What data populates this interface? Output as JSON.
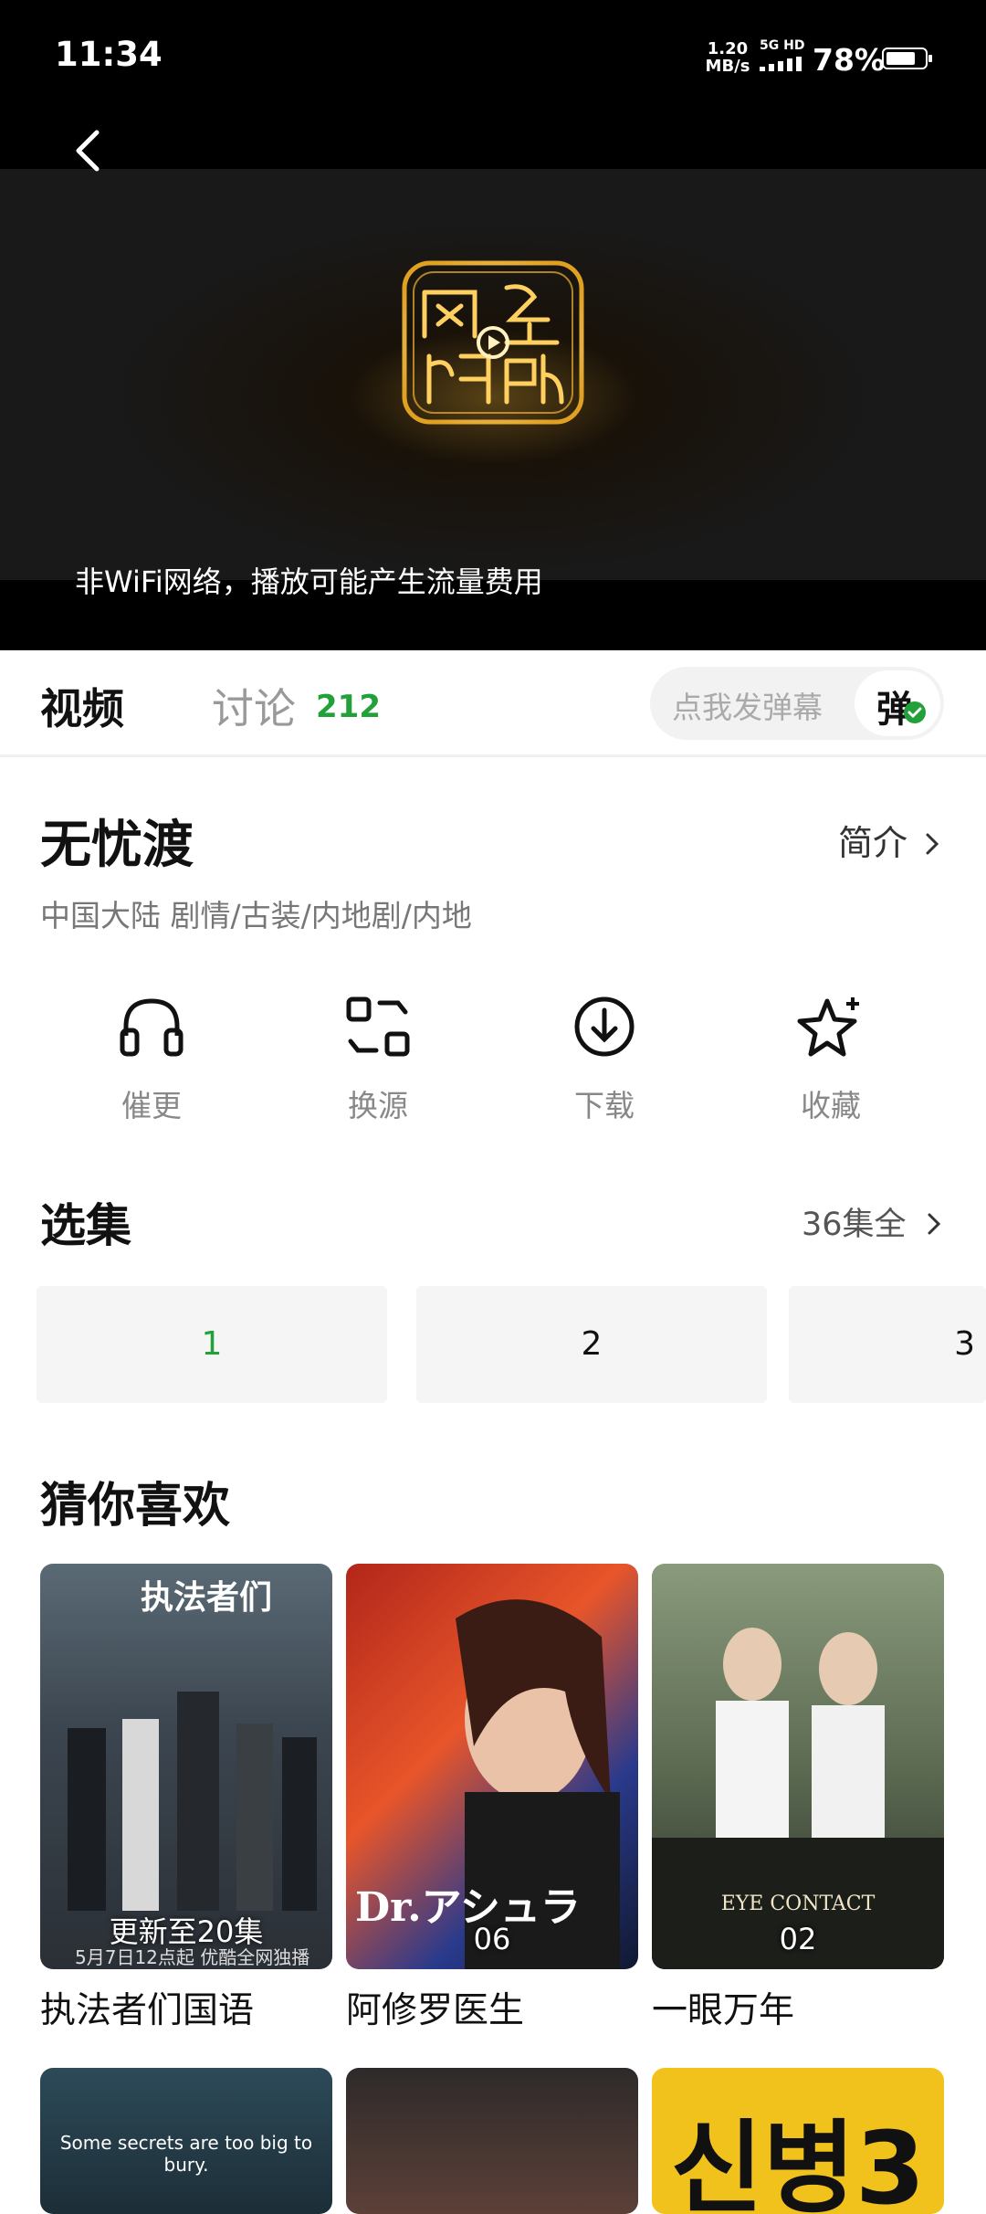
{
  "status_bar": {
    "time": "11:34",
    "net_speed_value": "1.20",
    "net_speed_unit": "MB/s",
    "network_label": "5G HD",
    "battery_percent": "78%",
    "battery_level": 0.78
  },
  "player": {
    "wifi_notice": "非WiFi网络，播放可能产生流量费用",
    "logo_icon": "wangluo-shiting-logo"
  },
  "tabs": {
    "video": "视频",
    "discuss": "讨论",
    "discuss_count": "212",
    "danmaku_placeholder": "点我发弹幕",
    "danmaku_button": "弹"
  },
  "show": {
    "title": "无忧渡",
    "intro_link": "简介",
    "meta": "中国大陆  剧情/古装/内地剧/内地"
  },
  "actions": [
    {
      "label": "催更",
      "icon": "headphones-icon"
    },
    {
      "label": "换源",
      "icon": "switch-source-icon"
    },
    {
      "label": "下载",
      "icon": "download-icon"
    },
    {
      "label": "收藏",
      "icon": "star-icon"
    }
  ],
  "episodes": {
    "heading": "选集",
    "count_link": "36集全",
    "items": [
      "1",
      "2",
      "3"
    ],
    "selected": "1"
  },
  "recommendations": {
    "heading": "猜你喜欢",
    "items": [
      {
        "title": "执法者们国语",
        "badge": "更新至20集",
        "poster_caption": "执法者们",
        "poster_note": "5月7日12点起 优酷全网独播"
      },
      {
        "title": "阿修罗医生",
        "badge": "06",
        "poster_caption": "Dr.アシュラ"
      },
      {
        "title": "一眼万年",
        "badge": "02",
        "poster_caption": "EYE CONTACT"
      }
    ],
    "second_row_captions": [
      "Some secrets are too big to bury.",
      "",
      "신병3"
    ]
  },
  "colors": {
    "accent_green": "#22a03a",
    "status_bar_bg": "#000000"
  }
}
